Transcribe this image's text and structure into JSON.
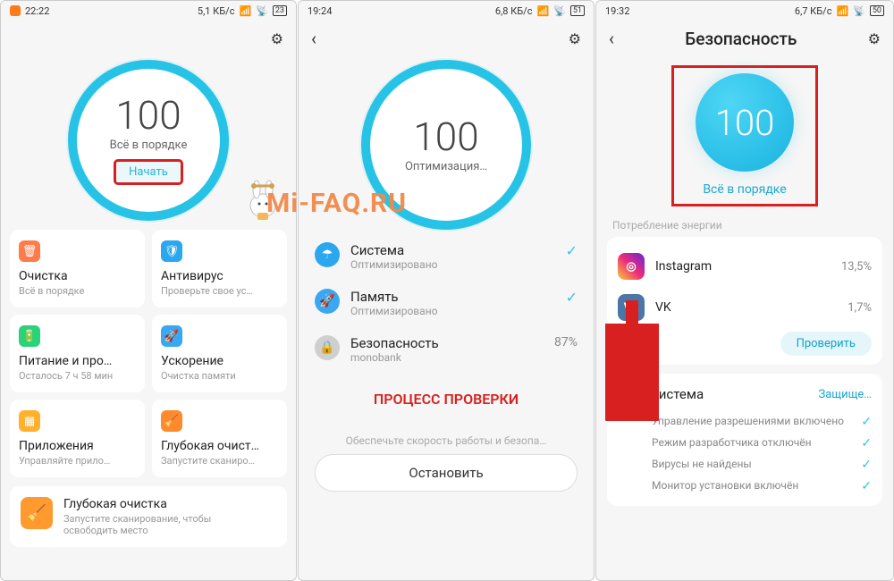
{
  "watermark": "Mi-FAQ.RU",
  "screen1": {
    "status": {
      "time": "22:22",
      "net": "5,1 КБ/с",
      "batt": "23"
    },
    "score": "100",
    "score_sub": "Всё в порядке",
    "start_btn": "Начать",
    "tiles": [
      {
        "icon": "trash",
        "color": "#ff7b4a",
        "label": "Очистка",
        "desc": "Всё в порядке"
      },
      {
        "icon": "shield",
        "color": "#2aa7ee",
        "label": "Антивирус",
        "desc": "Проверьте свое ус…"
      },
      {
        "icon": "battery",
        "color": "#2bd27a",
        "label": "Питание и про…",
        "desc": "Осталось 7 ч 58 мин"
      },
      {
        "icon": "rocket",
        "color": "#3aa7f2",
        "label": "Ускорение",
        "desc": "Очистка памяти"
      },
      {
        "icon": "grid",
        "color": "#ffb12e",
        "label": "Приложения",
        "desc": "Управляйте прило…"
      },
      {
        "icon": "broom",
        "color": "#ff8a2e",
        "label": "Глубокая очист…",
        "desc": "Запустите сканиро…"
      }
    ],
    "promo": {
      "title": "Глубокая очистка",
      "desc": "Запустите сканирование, чтобы освободить место"
    }
  },
  "screen2": {
    "status": {
      "time": "19:24",
      "net": "6,8 КБ/с",
      "batt": "51"
    },
    "score": "100",
    "score_sub": "Оптимизация…",
    "rows": [
      {
        "icon": "umbrella",
        "color": "#2aa7ee",
        "title": "Система",
        "desc": "Оптимизировано",
        "val_type": "check"
      },
      {
        "icon": "rocket",
        "color": "#3aa7f2",
        "title": "Память",
        "desc": "Оптимизировано",
        "val_type": "check"
      },
      {
        "icon": "lock",
        "color": "#cfcfcf",
        "title": "Безопасность",
        "desc": "monobank",
        "val_type": "text",
        "val": "87%"
      }
    ],
    "caption": "ПРОЦЕСС ПРОВЕРКИ",
    "hint": "Обеспечьте скорость работы и безопа…",
    "stop_btn": "Остановить"
  },
  "screen3": {
    "status": {
      "time": "19:32",
      "net": "6,7 КБ/с",
      "batt": "50"
    },
    "title": "Безопасность",
    "score": "100",
    "score_sub": "Всё в порядке",
    "energy_header": "Потребление энергии",
    "apps": [
      {
        "name": "Instagram",
        "pct": "13,5%",
        "cls": "ig"
      },
      {
        "name": "VK",
        "pct": "1,7%",
        "cls": "vk",
        "glyph": "VK"
      }
    ],
    "check_btn": "Проверить",
    "system": {
      "title": "Система",
      "status": "Защище…"
    },
    "sys_items": [
      "Управление разрешениями включено",
      "Режим разработчика отключён",
      "Вирусы не найдены",
      "Монитор установки включён"
    ]
  }
}
